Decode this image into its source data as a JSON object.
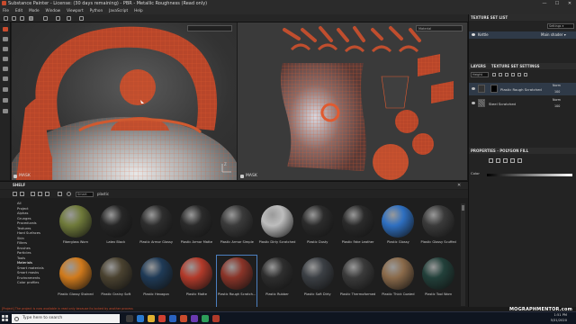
{
  "window": {
    "title": "Substance Painter - License: (30 days remaining) - PBR - Metallic Roughness (Read only)",
    "min": "—",
    "max": "☐",
    "close": "✕"
  },
  "menu": [
    "File",
    "Edit",
    "Mode",
    "Window",
    "Viewport",
    "Python",
    "JavaScript",
    "Help"
  ],
  "viewport": {
    "material_label": "Material",
    "mode_left": "",
    "mode_right": "Material",
    "mask_left": "MASK",
    "mask_right": "MASK"
  },
  "texture_set_list": {
    "title": "TEXTURE SET LIST",
    "settings": "Settings ▾",
    "set_name": "Kettle",
    "shader": "Main shader ▾"
  },
  "layers_panel": {
    "tab_layers": "LAYERS",
    "tab_tss": "TEXTURE SET SETTINGS",
    "channel": "Height",
    "blend": "Norm",
    "opacity": "100",
    "layers": [
      {
        "name": "Plastic Rough Scratched",
        "fill": "Fill mask",
        "blend": "Norm",
        "opacity": "100"
      },
      {
        "name": "Steel Scratched",
        "fill": "",
        "blend": "Norm",
        "opacity": "100"
      }
    ]
  },
  "properties": {
    "title": "PROPERTIES - POLYGON FILL",
    "color_label": "Color"
  },
  "shelf": {
    "title": "SHELF",
    "search_text": "Smart",
    "filter": "plastic",
    "categories": [
      "All",
      "Project",
      "Alphas",
      "Grunges",
      "Procedurals",
      "Textures",
      "Hard Surfaces",
      "Skin",
      "Filters",
      "Brushes",
      "Particles",
      "Tools",
      "Materials",
      "Smart materials",
      "Smart masks",
      "Environments",
      "Color profiles"
    ],
    "active_category": "Materials",
    "materials": [
      {
        "name": "Fiberglass Worn",
        "color": "#6f7a3a"
      },
      {
        "name": "Latex Black",
        "color": "#262626"
      },
      {
        "name": "Plastic Armor Glossy",
        "color": "#2d2d2d"
      },
      {
        "name": "Plastic Armor Matte",
        "color": "#2a2a2a"
      },
      {
        "name": "Plastic Armor Simple",
        "color": "#3a3a3a"
      },
      {
        "name": "Plastic Dirty Scratched",
        "color": "#bdbdbd"
      },
      {
        "name": "Plastic Dusty",
        "color": "#2b2b2b"
      },
      {
        "name": "Plastic Fake Leather",
        "color": "#2a2a2a"
      },
      {
        "name": "Plastic Glossy",
        "color": "#2e6fc0"
      },
      {
        "name": "Plastic Glossy Scuffed",
        "color": "#3a3a3a"
      },
      {
        "name": "Plastic Glossy Stained",
        "color": "#d07a1c"
      },
      {
        "name": "Plastic Grainy Soft",
        "color": "#4a4230"
      },
      {
        "name": "Plastic Hexagon",
        "color": "#1f3a56"
      },
      {
        "name": "Plastic Matte",
        "color": "#b23a2a"
      },
      {
        "name": "Plastic Rough Scratch...",
        "color": "#8a3428"
      },
      {
        "name": "Plastic Rubber",
        "color": "#2e2e2e"
      },
      {
        "name": "Plastic Soft Dirty",
        "color": "#3b3f44"
      },
      {
        "name": "Plastic Thermoformed",
        "color": "#3a3a3a"
      },
      {
        "name": "Plastic Thick Coated",
        "color": "#8a6a4a"
      },
      {
        "name": "Plastic Tool Worn",
        "color": "#22403a"
      }
    ],
    "selected_index": 14
  },
  "status_bar": "[Project] The project is now available in read only because its locked by another process",
  "taskbar": {
    "search_placeholder": "Type here to search",
    "time": "1:51 PM",
    "date": "5/31/2020"
  },
  "watermark": "MOGRAPHMENTOR.com"
}
